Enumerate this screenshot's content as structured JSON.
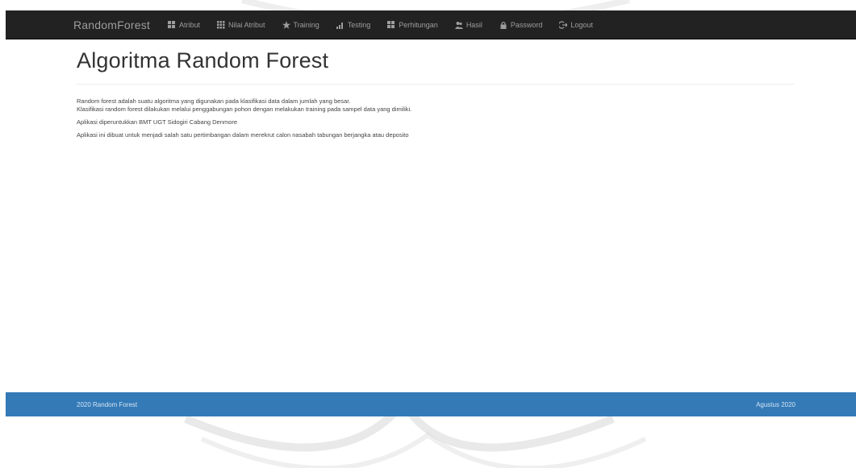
{
  "navbar": {
    "brand": "RandomForest",
    "items": [
      {
        "label": "Atribut",
        "icon": "grid-icon"
      },
      {
        "label": "Nilai Atribut",
        "icon": "list-icon"
      },
      {
        "label": "Training",
        "icon": "star-icon"
      },
      {
        "label": "Testing",
        "icon": "signal-icon"
      },
      {
        "label": "Perhitungan",
        "icon": "grid-icon"
      },
      {
        "label": "Hasil",
        "icon": "users-icon"
      },
      {
        "label": "Password",
        "icon": "lock-icon"
      },
      {
        "label": "Logout",
        "icon": "logout-icon"
      }
    ]
  },
  "main": {
    "title": "Algoritma Random Forest",
    "paragraphs": [
      [
        "Random forest adalah suatu algoritma yang digunakan pada klasifikasi data dalam jumlah yang besar.",
        "Klasifikasi random forest dilakukan melalui penggabungan pohon dengan melakukan training pada sampel data yang dimiliki."
      ],
      [
        "Aplikasi diperuntukkan BMT UGT Sidogiri Cabang Denmore"
      ],
      [
        "Aplikasi ini dibuat untuk menjadi salah satu pertimbangan dalam merekrut calon nasabah tabungan berjangka atau deposito"
      ]
    ]
  },
  "footer": {
    "left": "2020 Random Forest",
    "right": "Agustus 2020"
  },
  "colors": {
    "navbar_bg": "#222222",
    "nav_text": "#9d9d9d",
    "footer_bg": "#337ab7"
  }
}
